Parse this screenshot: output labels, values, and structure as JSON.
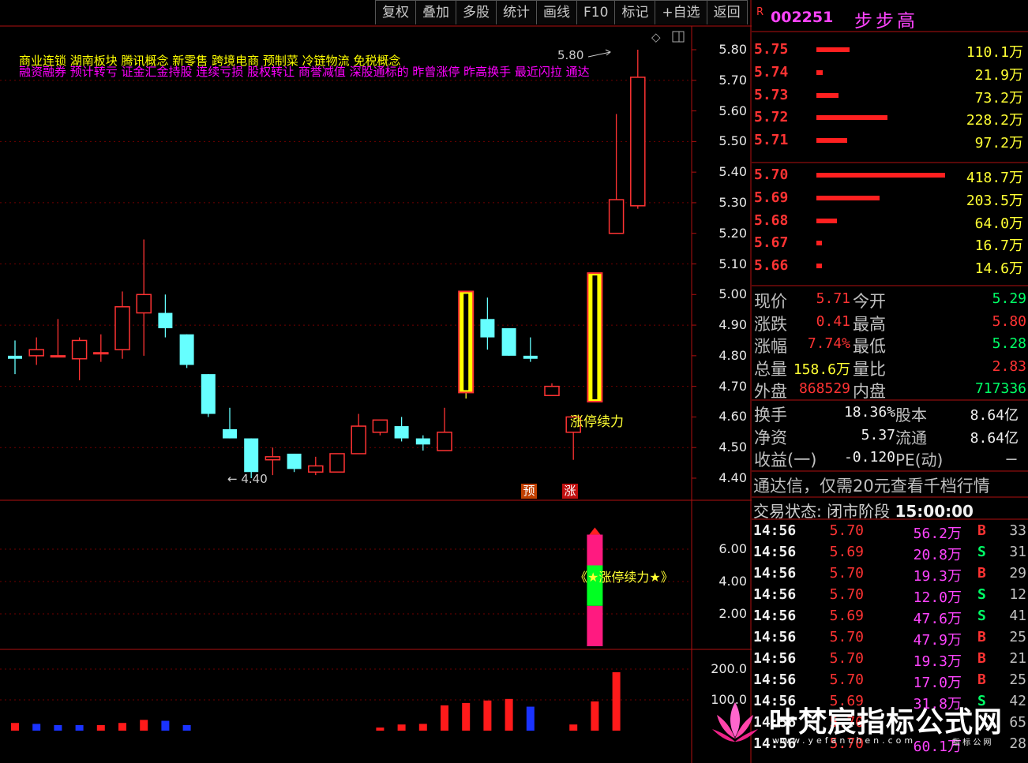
{
  "toolbar": [
    "复权",
    "叠加",
    "多股",
    "统计",
    "画线",
    "F10",
    "标记",
    "+自选",
    "返回"
  ],
  "stock": {
    "badge": "R",
    "code": "002251",
    "name": "步步高"
  },
  "concepts": {
    "line1": "商业连锁  湖南板块  腾讯概念 新零售 跨境电商 预制菜 冷链物流 免税概念",
    "line2": "融资融券 预计转亏 证金汇金持股 连续亏损 股权转让 商誉减值 深股通标的 昨曾涨停 昨高换手 最近闪拉 通达"
  },
  "main_chart": {
    "y_ticks": [
      "5.80",
      "5.70",
      "5.60",
      "5.50",
      "5.40",
      "5.30",
      "5.20",
      "5.10",
      "5.00",
      "4.90",
      "4.80",
      "4.70",
      "4.60",
      "4.50",
      "4.40"
    ],
    "high_label": "5.80",
    "low_label": "← 4.40",
    "signal_text": "涨停续力",
    "tag_yu": "预",
    "tag_zhang": "涨"
  },
  "indicator": {
    "y_ticks": [
      "6.00",
      "4.00",
      "2.00"
    ],
    "label": "《★涨停续力★》"
  },
  "volume": {
    "y_ticks": [
      "200.0",
      "100.0"
    ]
  },
  "order_book": {
    "asks": [
      {
        "price": "5.75",
        "vol": "110.1万",
        "bar": 0.26
      },
      {
        "price": "5.74",
        "vol": "21.9万",
        "bar": 0.05
      },
      {
        "price": "5.73",
        "vol": "73.2万",
        "bar": 0.17
      },
      {
        "price": "5.72",
        "vol": "228.2万",
        "bar": 0.55
      },
      {
        "price": "5.71",
        "vol": "97.2万",
        "bar": 0.24
      }
    ],
    "bids": [
      {
        "price": "5.70",
        "vol": "418.7万",
        "bar": 1.0
      },
      {
        "price": "5.69",
        "vol": "203.5万",
        "bar": 0.49
      },
      {
        "price": "5.68",
        "vol": "64.0万",
        "bar": 0.16
      },
      {
        "price": "5.67",
        "vol": "16.7万",
        "bar": 0.04
      },
      {
        "price": "5.66",
        "vol": "14.6万",
        "bar": 0.04
      }
    ]
  },
  "quote": [
    {
      "l1": "现价",
      "v1": "5.71",
      "l2": "今开",
      "v2": "5.29"
    },
    {
      "l1": "涨跌",
      "v1": "0.41",
      "l2": "最高",
      "v2": "5.80"
    },
    {
      "l1": "涨幅",
      "v1": "7.74%",
      "l2": "最低",
      "v2": "5.28"
    },
    {
      "l1": "总量",
      "v1": "158.6万",
      "l2": "量比",
      "v2": "2.83"
    },
    {
      "l1": "外盘",
      "v1": "868529",
      "l2": "内盘",
      "v2": "717336"
    }
  ],
  "stats": [
    {
      "l1": "换手",
      "v1": "18.36%",
      "l2": "股本",
      "v2": "8.64亿"
    },
    {
      "l1": "净资",
      "v1": "5.37",
      "l2": "流通",
      "v2": "8.64亿"
    },
    {
      "l1": "收益(一)",
      "v1": "-0.120",
      "l2": "PE(动)",
      "v2": "－"
    }
  ],
  "notice": "通达信，仅需20元查看千档行情",
  "status": {
    "label": "交易状态: 闭市阶段",
    "time": "15:00:00"
  },
  "ticks": [
    {
      "t": "14:56",
      "p": "5.70",
      "v": "56.2万",
      "s": "B",
      "n": "33"
    },
    {
      "t": "14:56",
      "p": "5.69",
      "v": "20.8万",
      "s": "S",
      "n": "31"
    },
    {
      "t": "14:56",
      "p": "5.70",
      "v": "19.3万",
      "s": "B",
      "n": "29"
    },
    {
      "t": "14:56",
      "p": "5.70",
      "v": "12.0万",
      "s": "S",
      "n": "12"
    },
    {
      "t": "14:56",
      "p": "5.69",
      "v": "47.6万",
      "s": "S",
      "n": "41"
    },
    {
      "t": "14:56",
      "p": "5.70",
      "v": "47.9万",
      "s": "B",
      "n": "25"
    },
    {
      "t": "14:56",
      "p": "5.70",
      "v": "19.3万",
      "s": "B",
      "n": "21"
    },
    {
      "t": "14:56",
      "p": "5.70",
      "v": "17.0万",
      "s": "B",
      "n": "25"
    },
    {
      "t": "14:56",
      "p": "5.69",
      "v": "31.8万",
      "s": "S",
      "n": "42"
    },
    {
      "t": "14:56",
      "p": "5.70",
      "v": "",
      "s": "",
      "n": "65"
    },
    {
      "t": "14:56",
      "p": "5.70",
      "v": "60.1万",
      "s": "",
      "n": "28"
    }
  ],
  "watermark": {
    "title": "叶梵宸指标公式网",
    "url": "www.yefanchen.com",
    "sub": "指 标 公 网"
  },
  "chart_data": {
    "type": "candlestick",
    "y_range": [
      4.4,
      5.8
    ],
    "candles": [
      {
        "o": 4.8,
        "h": 4.85,
        "l": 4.74,
        "c": 4.79
      },
      {
        "o": 4.8,
        "h": 4.86,
        "l": 4.77,
        "c": 4.82
      },
      {
        "o": 4.8,
        "h": 4.92,
        "l": 4.8,
        "c": 4.8
      },
      {
        "o": 4.79,
        "h": 4.86,
        "l": 4.72,
        "c": 4.85
      },
      {
        "o": 4.81,
        "h": 4.87,
        "l": 4.78,
        "c": 4.81
      },
      {
        "o": 4.82,
        "h": 5.01,
        "l": 4.79,
        "c": 4.96
      },
      {
        "o": 4.94,
        "h": 5.18,
        "l": 4.8,
        "c": 5.0
      },
      {
        "o": 4.94,
        "h": 5.0,
        "l": 4.86,
        "c": 4.89
      },
      {
        "o": 4.87,
        "h": 4.87,
        "l": 4.76,
        "c": 4.77
      },
      {
        "o": 4.74,
        "h": 4.74,
        "l": 4.6,
        "c": 4.61
      },
      {
        "o": 4.56,
        "h": 4.63,
        "l": 4.53,
        "c": 4.53
      },
      {
        "o": 4.53,
        "h": 4.53,
        "l": 4.4,
        "c": 4.42
      },
      {
        "o": 4.46,
        "h": 4.5,
        "l": 4.41,
        "c": 4.47
      },
      {
        "o": 4.48,
        "h": 4.48,
        "l": 4.42,
        "c": 4.43
      },
      {
        "o": 4.42,
        "h": 4.47,
        "l": 4.41,
        "c": 4.44
      },
      {
        "o": 4.42,
        "h": 4.48,
        "l": 4.42,
        "c": 4.48
      },
      {
        "o": 4.48,
        "h": 4.61,
        "l": 4.48,
        "c": 4.57
      },
      {
        "o": 4.55,
        "h": 4.59,
        "l": 4.54,
        "c": 4.59
      },
      {
        "o": 4.57,
        "h": 4.6,
        "l": 4.52,
        "c": 4.53
      },
      {
        "o": 4.53,
        "h": 4.54,
        "l": 4.49,
        "c": 4.51
      },
      {
        "o": 4.49,
        "h": 4.63,
        "l": 4.49,
        "c": 4.55
      },
      {
        "o": 4.68,
        "h": 5.01,
        "l": 4.66,
        "c": 5.01
      },
      {
        "o": 4.92,
        "h": 4.99,
        "l": 4.82,
        "c": 4.86
      },
      {
        "o": 4.89,
        "h": 4.89,
        "l": 4.8,
        "c": 4.8
      },
      {
        "o": 4.8,
        "h": 4.86,
        "l": 4.78,
        "c": 4.79
      },
      {
        "o": 4.67,
        "h": 4.71,
        "l": 4.67,
        "c": 4.7
      },
      {
        "o": 4.55,
        "h": 4.6,
        "l": 4.46,
        "c": 4.6
      },
      {
        "o": 4.65,
        "h": 5.07,
        "l": 4.65,
        "c": 5.07
      },
      {
        "o": 5.2,
        "h": 5.59,
        "l": 5.2,
        "c": 5.31
      },
      {
        "o": 5.29,
        "h": 5.8,
        "l": 5.28,
        "c": 5.71
      }
    ],
    "limit_up_days": [
      21,
      27
    ],
    "volume": [
      {
        "i": 0,
        "v": 25,
        "up": true
      },
      {
        "i": 1,
        "v": 22,
        "up": false
      },
      {
        "i": 2,
        "v": 18,
        "up": false
      },
      {
        "i": 3,
        "v": 18,
        "up": false
      },
      {
        "i": 4,
        "v": 18,
        "up": true
      },
      {
        "i": 5,
        "v": 25,
        "up": true
      },
      {
        "i": 6,
        "v": 35,
        "up": true
      },
      {
        "i": 7,
        "v": 32,
        "up": false
      },
      {
        "i": 8,
        "v": 18,
        "up": false
      },
      {
        "i": 17,
        "v": 10,
        "up": true
      },
      {
        "i": 18,
        "v": 20,
        "up": true
      },
      {
        "i": 19,
        "v": 22,
        "up": true
      },
      {
        "i": 20,
        "v": 82,
        "up": true
      },
      {
        "i": 21,
        "v": 90,
        "up": true
      },
      {
        "i": 22,
        "v": 98,
        "up": true
      },
      {
        "i": 23,
        "v": 103,
        "up": true
      },
      {
        "i": 24,
        "v": 78,
        "up": false
      },
      {
        "i": 26,
        "v": 20,
        "up": true
      },
      {
        "i": 27,
        "v": 95,
        "up": true
      },
      {
        "i": 28,
        "v": 190,
        "up": true
      }
    ],
    "indicator_bar": {
      "i": 27,
      "segments": [
        {
          "from": 0,
          "to": 2.5,
          "color": "#ff1a80"
        },
        {
          "from": 2.5,
          "to": 5.0,
          "color": "#00ff22"
        },
        {
          "from": 5.0,
          "to": 6.9,
          "color": "#ff1a80"
        }
      ]
    }
  }
}
